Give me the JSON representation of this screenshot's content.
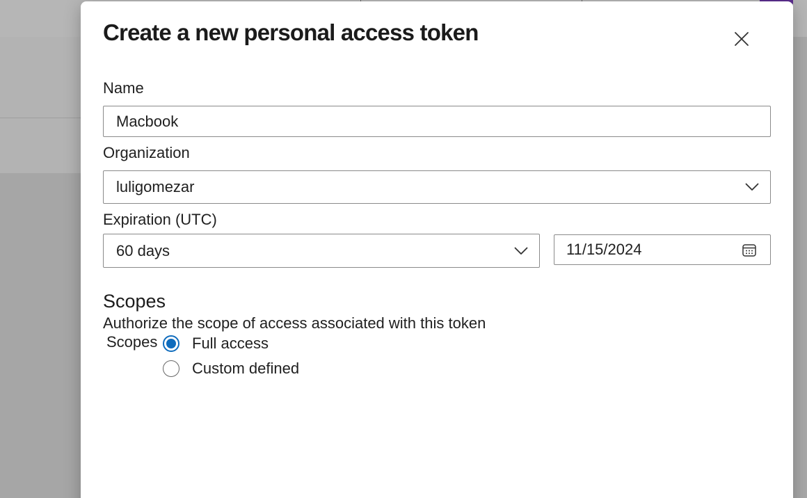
{
  "modal": {
    "title": "Create a new personal access token"
  },
  "form": {
    "name_label": "Name",
    "name_value": "Macbook",
    "organization_label": "Organization",
    "organization_value": "luligomezar",
    "expiration_label": "Expiration (UTC)",
    "expiration_value": "60 days",
    "expiration_date": "11/15/2024"
  },
  "scopes": {
    "heading": "Scopes",
    "description": "Authorize the scope of access associated with this token",
    "group_label": "Scopes",
    "options": [
      {
        "label": "Full access",
        "checked": true
      },
      {
        "label": "Custom defined",
        "checked": false
      }
    ]
  },
  "colors": {
    "accent": "#0f6cbd",
    "background_accent": "#5b2d8e"
  },
  "icons": {
    "close": "close-icon",
    "dropdown": "chevron-down-icon",
    "calendar": "calendar-icon"
  }
}
